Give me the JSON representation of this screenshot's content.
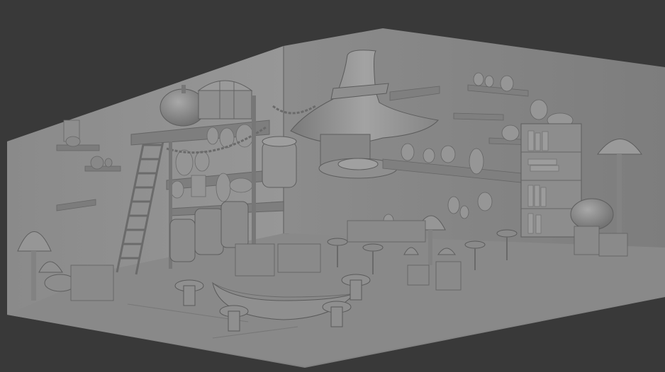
{
  "viewport": {
    "background_color": "#393939",
    "model_color": "#8a8a8a",
    "description_visible_text": ""
  },
  "scene": {
    "objects": [
      "room-floor",
      "back-wall-left",
      "back-wall-right",
      "witch-hat-chimney",
      "ladder",
      "shelf-unit-left",
      "barrels",
      "treasure-chest",
      "pumpkin",
      "bookcase",
      "mushroom-lamp-right",
      "mushroom-lamp-left",
      "round-counter",
      "stools",
      "bar-stools",
      "hanging-shelves",
      "jars"
    ]
  }
}
